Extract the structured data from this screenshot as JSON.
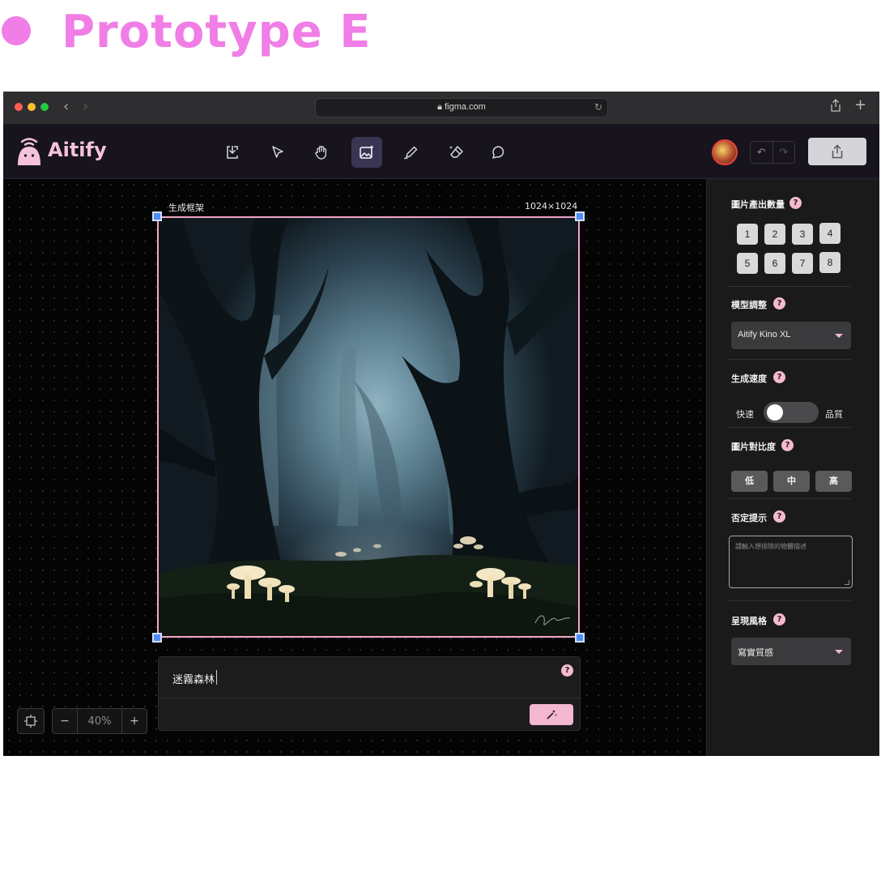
{
  "heading": {
    "title": "Prototype E"
  },
  "browser": {
    "url": "figma.com"
  },
  "app": {
    "name": "Aitify",
    "tools": [
      "import-icon",
      "select-arrow-icon",
      "hand-pan-icon",
      "image-generate-icon",
      "pen-draw-icon",
      "eraser-icon",
      "comment-icon"
    ],
    "active_tool": "image-generate-icon"
  },
  "canvas": {
    "frame_name": "生成框架",
    "frame_size": "1024×1024",
    "prompt_value": "迷霧森林",
    "prompt_help": "?",
    "zoom_minus": "−",
    "zoom_value": "40%",
    "zoom_plus": "+"
  },
  "panel": {
    "count": {
      "title": "圖片產出數量",
      "help": "?",
      "options": [
        "1",
        "2",
        "3",
        "4",
        "5",
        "6",
        "7",
        "8"
      ]
    },
    "model": {
      "title": "模型調整",
      "help": "?",
      "value": "Aitify Kino XL"
    },
    "speed": {
      "title": "生成速度",
      "help": "?",
      "left_label": "快速",
      "right_label": "品質",
      "value": "快速"
    },
    "contrast": {
      "title": "圖片對比度",
      "help": "?",
      "options": [
        "低",
        "中",
        "高"
      ]
    },
    "negative": {
      "title": "否定提示",
      "help": "?",
      "placeholder": "請輸入想排除的物體描述"
    },
    "style": {
      "title": "呈現風格",
      "help": "?",
      "value": "寫實質感"
    }
  },
  "colors": {
    "accent_pink": "#f4b7d0",
    "heading_magenta": "#f07ee6",
    "handle_blue": "#4f8df6"
  }
}
